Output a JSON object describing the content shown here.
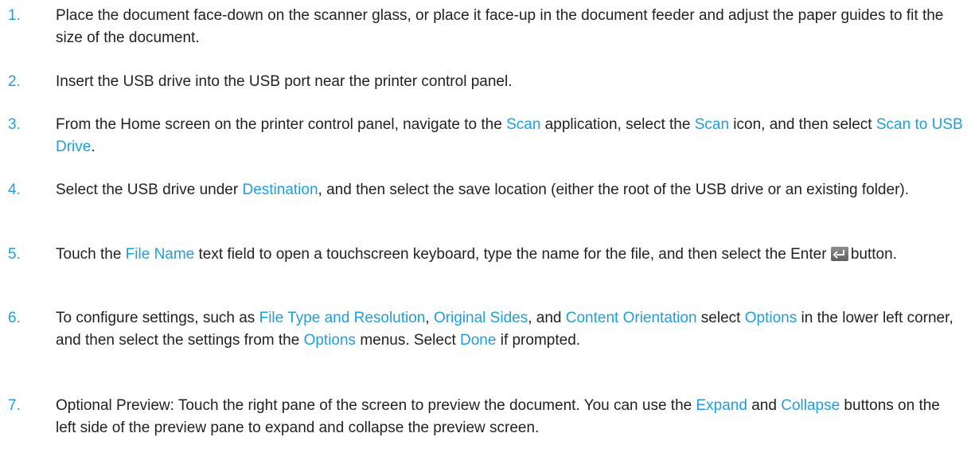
{
  "accent_color": "#1e9fdc",
  "steps": [
    {
      "number": "1.",
      "parts": [
        "Place the document face-down on the scanner glass, or place it face-up in the document feeder and adjust the paper guides to fit the size of the document."
      ]
    },
    {
      "number": "2.",
      "parts": [
        "Insert the USB drive into the USB port near the printer control panel."
      ]
    },
    {
      "number": "3.",
      "parts": [
        "From the Home screen on the printer control panel, navigate to the ",
        "Scan",
        " application, select the ",
        "Scan",
        " icon, and then select ",
        "Scan to USB Drive",
        "."
      ]
    },
    {
      "number": "4.",
      "parts": [
        "Select the USB drive under ",
        "Destination",
        ", and then select the save location (either the root of the USB drive or an existing folder)."
      ]
    },
    {
      "number": "5.",
      "parts": [
        "Touch the ",
        "File Name",
        " text field to open a touchscreen keyboard, type the name for the file, and then select the Enter",
        "button."
      ],
      "icon": "enter-icon"
    },
    {
      "number": "6.",
      "parts": [
        "To configure settings, such as ",
        "File Type and Resolution",
        ", ",
        "Original Sides",
        ", and ",
        "Content Orientation",
        " select ",
        "Options",
        " in the lower left corner, and then select the settings from the ",
        "Options",
        " menus. Select ",
        "Done",
        " if prompted."
      ]
    },
    {
      "number": "7.",
      "parts": [
        "Optional Preview: Touch the right pane of the screen to preview the document. You can use the ",
        "Expand",
        " and ",
        "Collapse",
        " buttons on the left side of the preview pane to expand and collapse the preview screen."
      ]
    }
  ]
}
